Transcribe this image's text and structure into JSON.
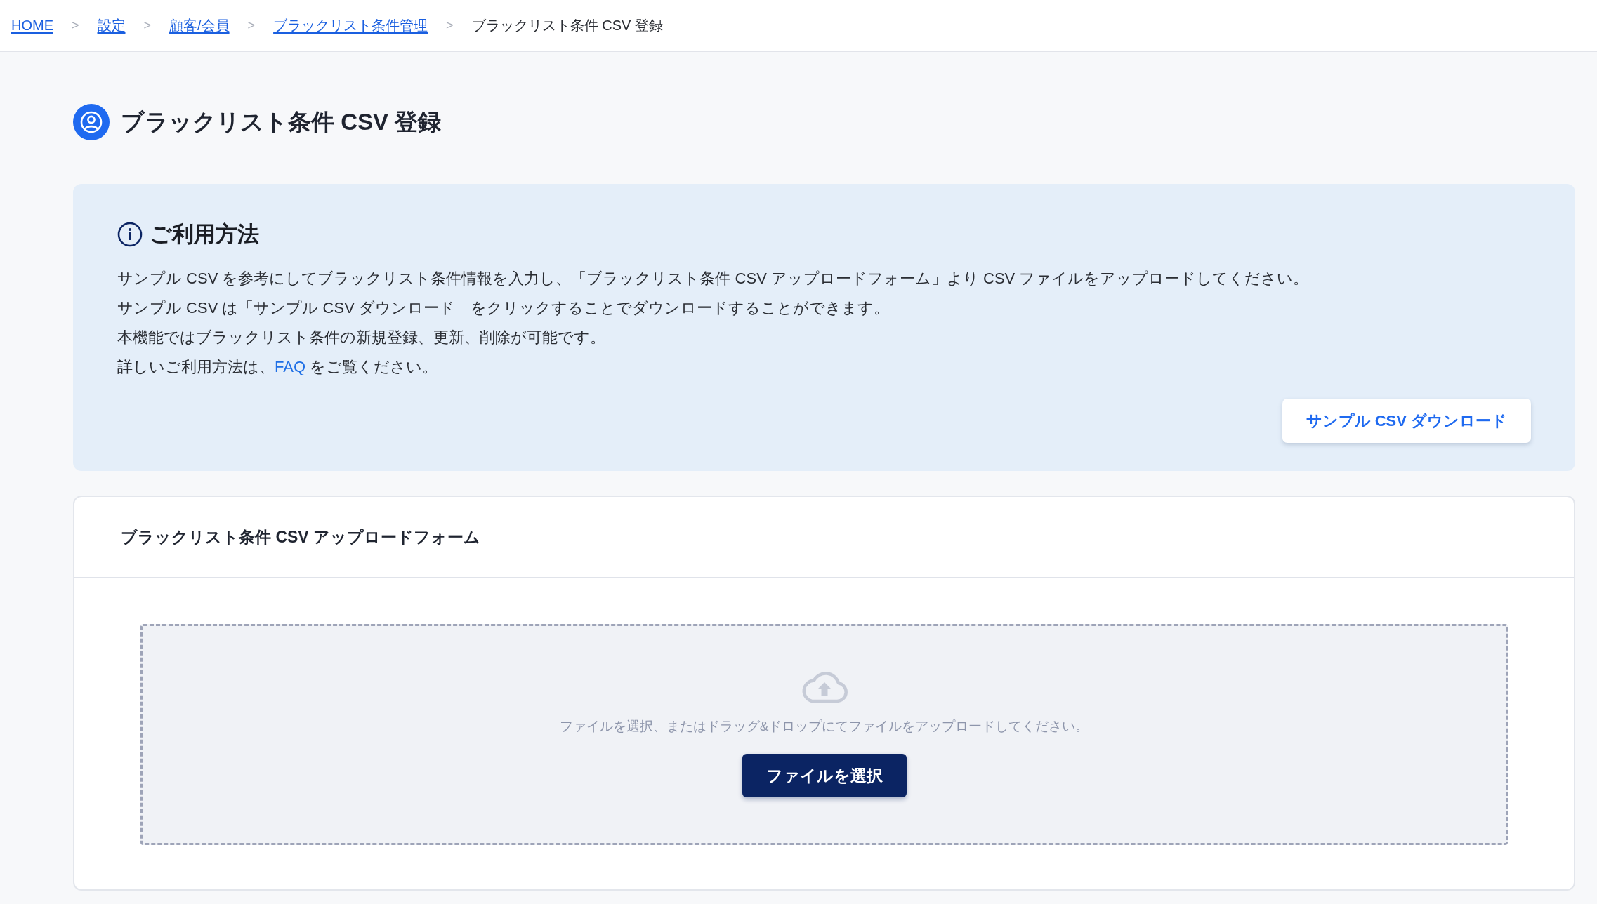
{
  "breadcrumb": [
    {
      "kind": "link",
      "label": "HOME"
    },
    {
      "kind": "separator",
      "label": ">"
    },
    {
      "kind": "link",
      "label": "設定"
    },
    {
      "kind": "separator",
      "label": ">"
    },
    {
      "kind": "link",
      "label": "顧客/会員"
    },
    {
      "kind": "separator",
      "label": ">"
    },
    {
      "kind": "link",
      "label": "ブラックリスト条件管理"
    },
    {
      "kind": "separator",
      "label": ">"
    },
    {
      "kind": "current",
      "label": "ブラックリスト条件 CSV 登録"
    }
  ],
  "page_title": "ブラックリスト条件 CSV 登録",
  "usage_panel": {
    "heading": "ご利用方法",
    "lines": [
      {
        "parts": [
          {
            "kind": "text",
            "text": "サンプル CSV を参考にしてブラックリスト条件情報を入力し、「ブラックリスト条件 CSV アップロードフォーム」より CSV ファイルをアップロードしてください。"
          }
        ]
      },
      {
        "parts": [
          {
            "kind": "text",
            "text": "サンプル CSV は「サンプル CSV ダウンロード」をクリックすることでダウンロードすることができます。"
          }
        ]
      },
      {
        "parts": [
          {
            "kind": "text",
            "text": "本機能ではブラックリスト条件の新規登録、更新、削除が可能です。"
          }
        ]
      },
      {
        "parts": [
          {
            "kind": "text",
            "text": "詳しいご利用方法は、"
          },
          {
            "kind": "link",
            "text": "FAQ"
          },
          {
            "kind": "text",
            "text": " をご覧ください。"
          }
        ]
      }
    ],
    "button": "サンプル CSV ダウンロード"
  },
  "upload_form": {
    "title": "ブラックリスト条件 CSV アップロードフォーム",
    "dropzone": {
      "hint": "ファイルを選択、またはドラッグ&ドロップにてファイルをアップロードしてください。",
      "button": "ファイルを選択"
    }
  }
}
